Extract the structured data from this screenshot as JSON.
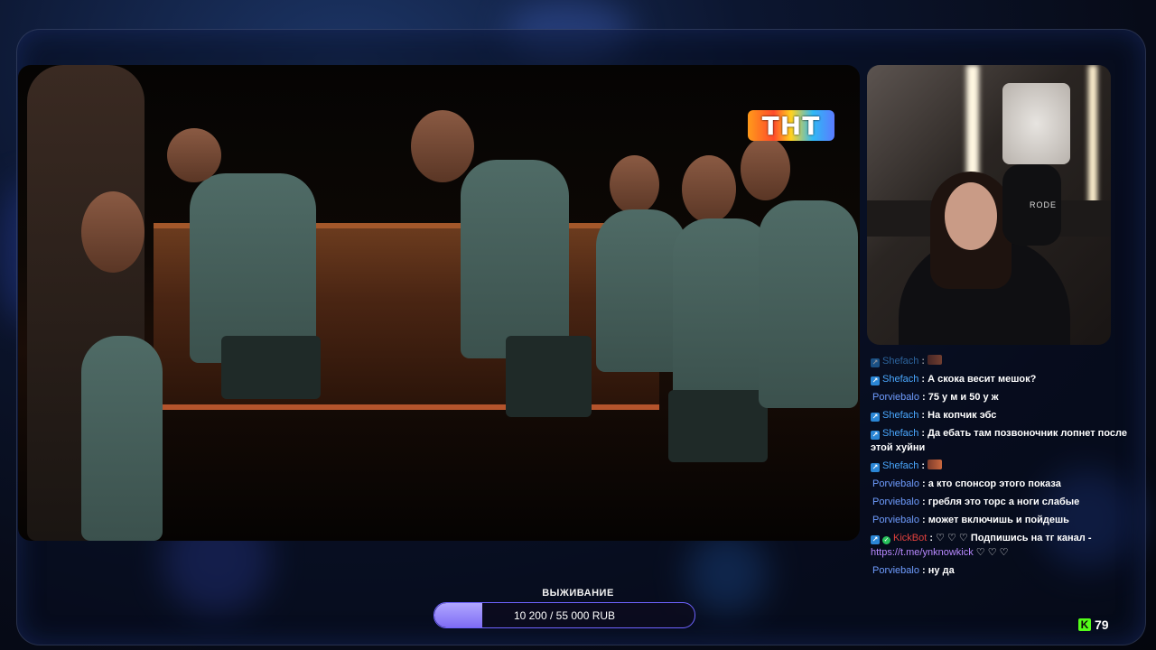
{
  "stream": {
    "channel_logo_text": "ТНТ",
    "webcam_mic_label": "RODE"
  },
  "chat": {
    "messages": [
      {
        "user": "Shefach",
        "text": "",
        "has_emote": true,
        "faded": true,
        "badge": "kick"
      },
      {
        "user": "Shefach",
        "text": "А скока весит мешок?",
        "badge": "kick"
      },
      {
        "user": "Porviebalo",
        "text": "75 у м и 50 у ж",
        "badge": "none"
      },
      {
        "user": "Shefach",
        "text": "На копчик эбс",
        "badge": "kick"
      },
      {
        "user": "Shefach",
        "text": "Да ебать там позвоночник лопнет после этой хуйни",
        "badge": "kick"
      },
      {
        "user": "Shefach",
        "text": "",
        "has_emote": true,
        "badge": "kick"
      },
      {
        "user": "Porviebalo",
        "text": "а кто спонсор этого показа",
        "badge": "none"
      },
      {
        "user": "Porviebalo",
        "text": "гребля это торс а ноги слабые",
        "badge": "none"
      },
      {
        "user": "Porviebalo",
        "text": "может включишь и пойдешь",
        "badge": "none"
      },
      {
        "user": "KickBot",
        "text": "♡ ♡ ♡ Подпишись на тг канал -",
        "link": "https://t.me/ynknowkick",
        "after_link": "♡ ♡ ♡",
        "badge": "bot"
      },
      {
        "user": "Porviebalo",
        "text": "ну да",
        "badge": "none"
      }
    ]
  },
  "goal": {
    "title": "ВЫЖИВАНИЕ",
    "progress_text": "10 200 / 55 000 RUB",
    "current": 10200,
    "target": 55000,
    "fill_color": "#8f7ff7",
    "border_color": "#6e63ff"
  },
  "viewers": {
    "platform_icon": "kick-icon",
    "count": "79",
    "accent": "#53fc18"
  }
}
